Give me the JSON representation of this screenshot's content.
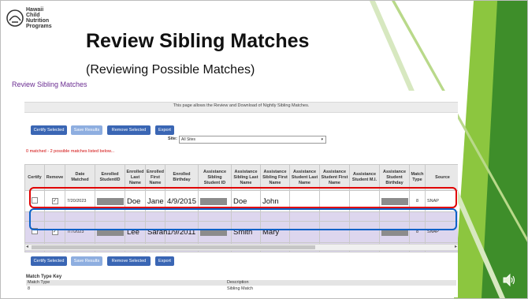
{
  "logo": {
    "lines": [
      "Hawaii",
      "Child",
      "Nutrition",
      "Programs"
    ]
  },
  "slide": {
    "title": "Review Sibling Matches",
    "subtitle": "(Reviewing Possible Matches)"
  },
  "panel": {
    "title": "Review Sibling Matches",
    "info": "This page allows the Review and Download of Nightly Sibling Matches.",
    "buttons": {
      "certify": "Certify Selected",
      "save": "Save Results",
      "remove": "Remove Selected",
      "export": "Export"
    },
    "site_label": "Site:",
    "site_value": "All Sites",
    "match_message": "0 matched - 2 possible matches listed below..."
  },
  "table": {
    "headers": [
      "Certify",
      "Remove",
      "Date Matched",
      "Enrolled StudentID",
      "Enrolled Last Name",
      "Enrolled First Name",
      "Enrolled Birthday",
      "Assistance Sibling Student ID",
      "Assistance Sibling Last Name",
      "Assistance Sibling First Name",
      "Assistance Student Last Name",
      "Assistance Student First Name",
      "Assistance Student M.I.",
      "Assistance Student Birthday",
      "Match Type",
      "Source"
    ],
    "rows": [
      {
        "certify": "",
        "remove": "✓",
        "date": "7/20/2023",
        "last": "Doe",
        "first": "Jane",
        "birthday": "4/9/2015",
        "sib_last": "Doe",
        "sib_first": "John",
        "match_type": "8",
        "source": "SNAP"
      },
      {
        "certify": "",
        "remove": "✓",
        "date": "7/7/2023",
        "last": "Lee",
        "first": "Sarah",
        "birthday": "1/9/2011",
        "sib_last": "Smith",
        "sib_first": "Mary",
        "match_type": "8",
        "source": "SNAP"
      }
    ]
  },
  "key": {
    "title": "Match Type Key",
    "col1": "Match Type",
    "col2": "Description",
    "row_type": "8",
    "row_desc": "Sibling Match"
  },
  "colors": {
    "green_dark": "#3e8e2a",
    "green_light": "#8cc63f",
    "highlight_red": "#e00000",
    "highlight_blue": "#0b62c8",
    "button_blue": "#3a66b4"
  },
  "icons": [
    "hawaii-logo-icon",
    "check-icon",
    "speaker-icon",
    "dropdown-arrow-icon"
  ]
}
